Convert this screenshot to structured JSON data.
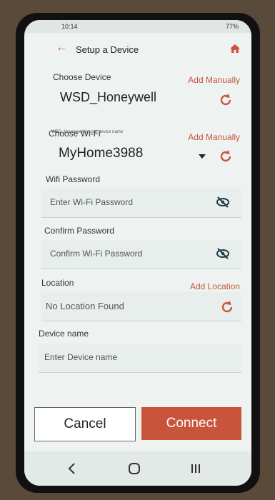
{
  "status": {
    "time": "10:14",
    "battery": "77%"
  },
  "header": {
    "title": "Setup a Device"
  },
  "device": {
    "label": "Choose Device",
    "add_manually": "Add Manually",
    "value": "WSD_Honeywell",
    "hint": "WSD_Honeywell is your device name"
  },
  "wifi": {
    "label": "Choose Wi-Fi",
    "add_manually": "Add Manually",
    "value": "MyHome3988"
  },
  "wifi_password": {
    "label": "Wifi Password",
    "placeholder": "Enter Wi-Fi Password"
  },
  "confirm_password": {
    "label": "Confirm Password",
    "placeholder": "Confirm Wi-Fi Password"
  },
  "location": {
    "label": "Location",
    "add_location": "Add Location",
    "value": "No Location Found"
  },
  "device_name": {
    "label": "Device name",
    "placeholder": "Enter Device name"
  },
  "buttons": {
    "cancel": "Cancel",
    "connect": "Connect"
  },
  "colors": {
    "accent": "#c8543b",
    "background": "#eef3f1"
  },
  "icons": {
    "back": "back-arrow-icon",
    "home": "home-icon",
    "refresh": "refresh-icon",
    "hide": "eye-off-icon",
    "dropdown": "caret-down-icon",
    "nav": [
      "back-nav-icon",
      "home-nav-icon",
      "recents-nav-icon"
    ]
  }
}
